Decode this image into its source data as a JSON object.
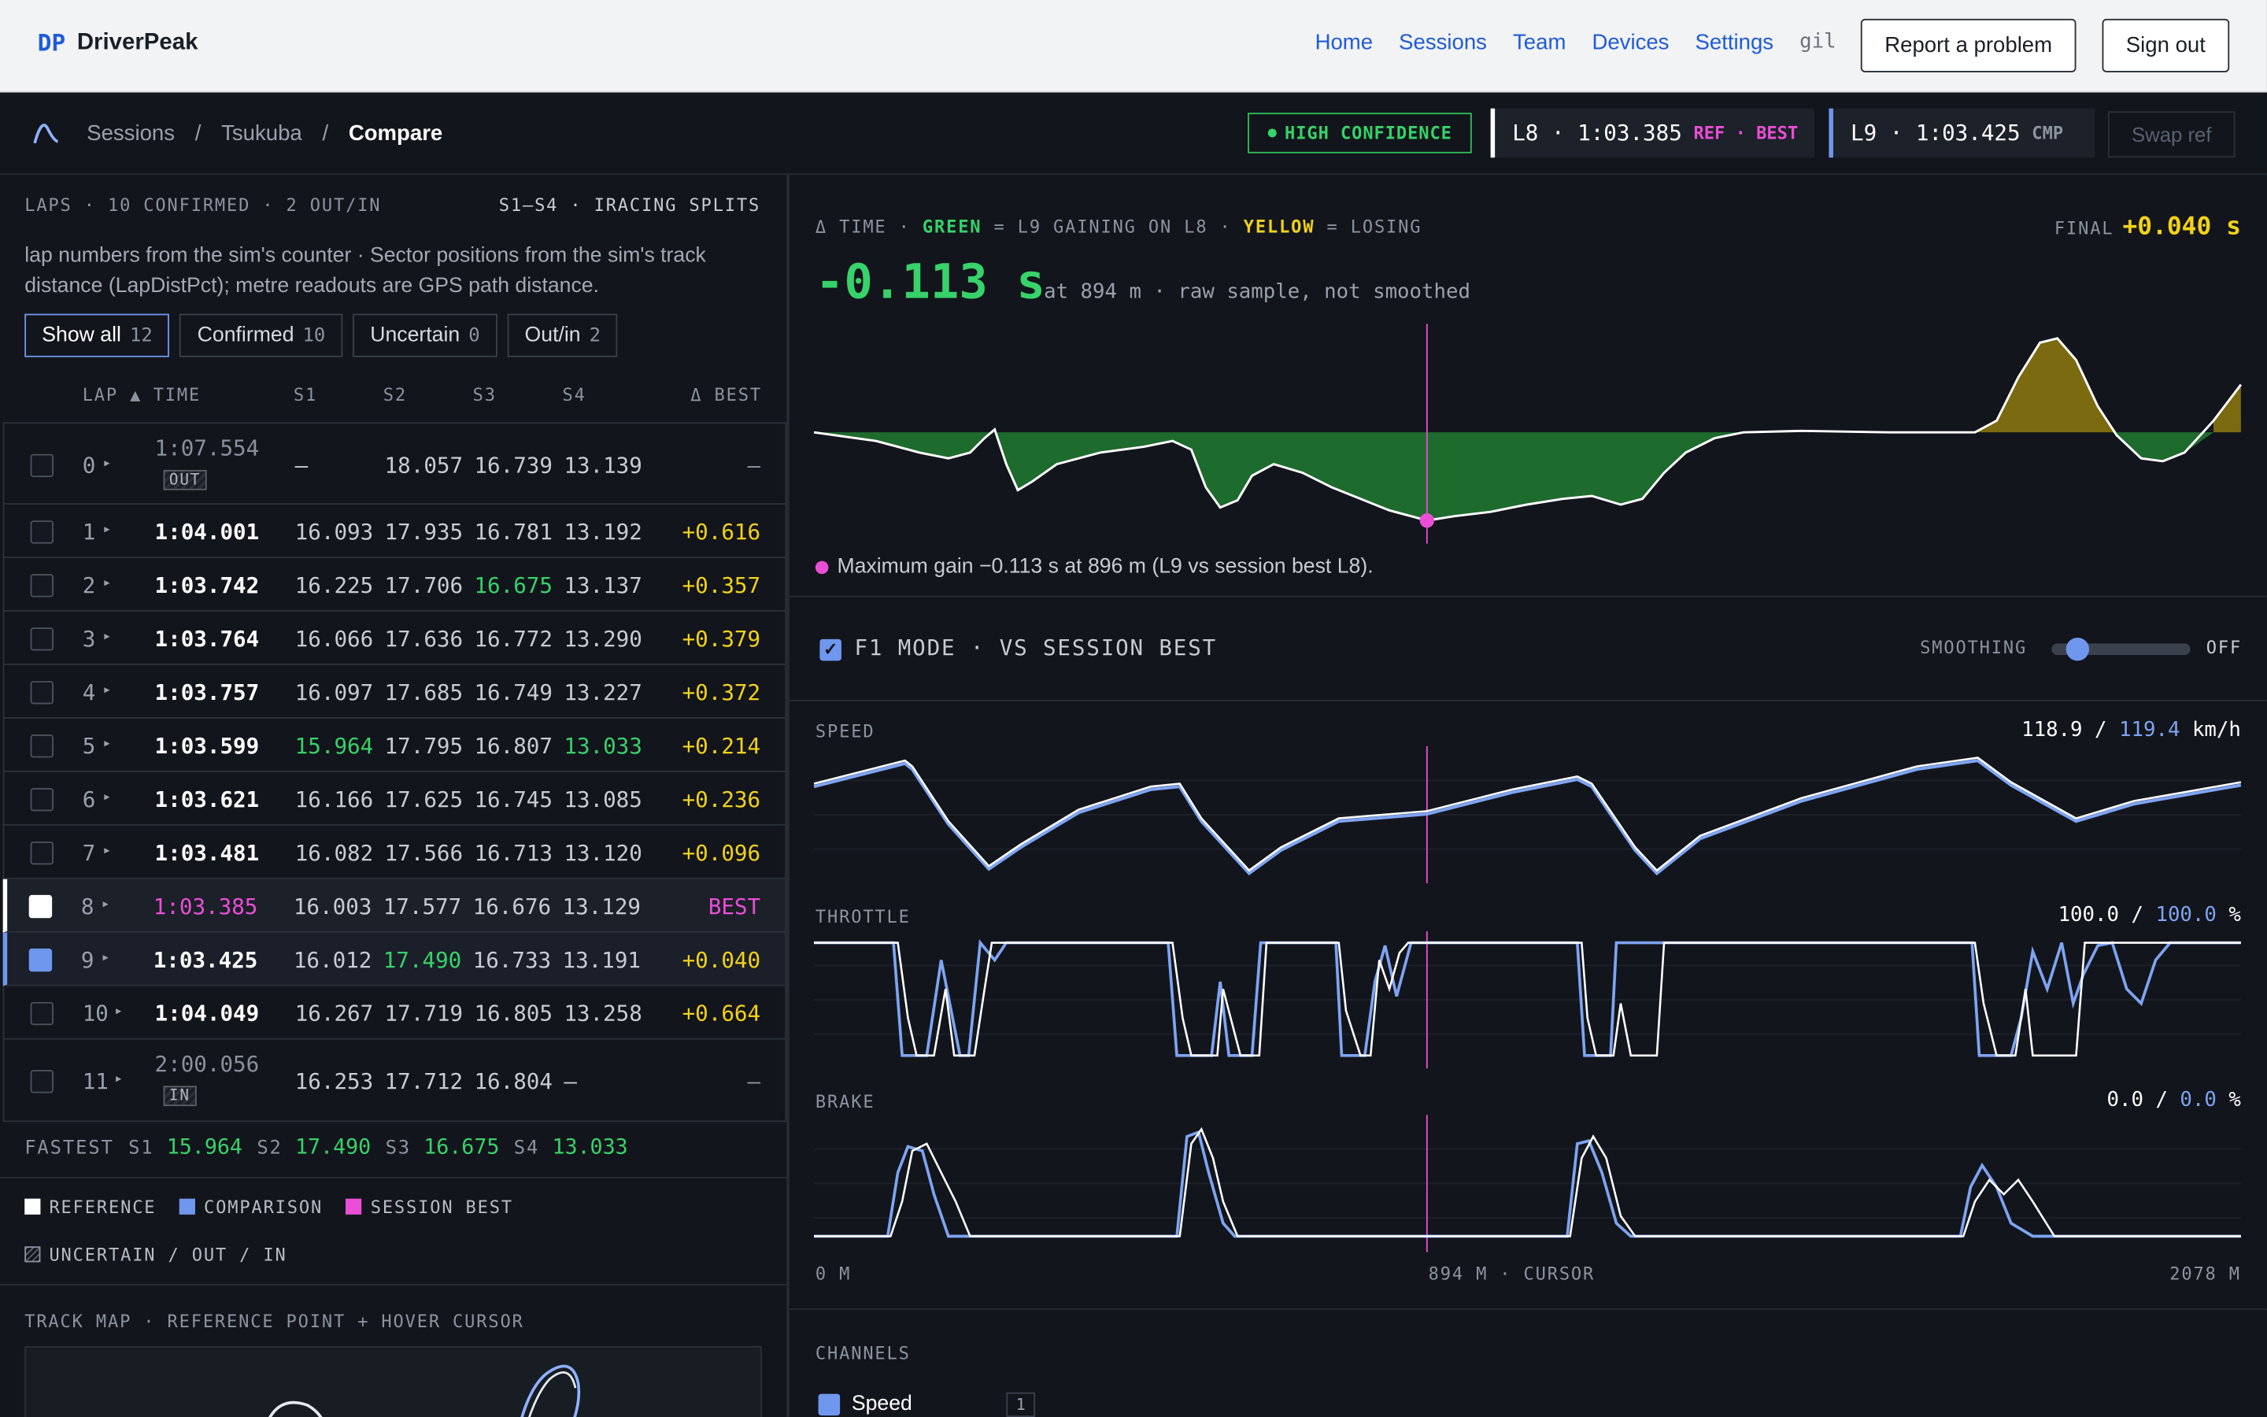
{
  "app": {
    "logo_mark": "DP",
    "name": "DriverPeak"
  },
  "nav": {
    "links": [
      "Home",
      "Sessions",
      "Team",
      "Devices",
      "Settings"
    ],
    "user": "gil",
    "report_label": "Report a problem",
    "signout_label": "Sign out"
  },
  "breadcrumb": {
    "items": [
      "Sessions",
      "Tsukuba",
      "Compare"
    ]
  },
  "confidence": "HIGH CONFIDENCE",
  "ref_chip": {
    "text": "L8 · 1:03.385",
    "tag": "REF · BEST",
    "color": "#ffffff"
  },
  "cmp_chip": {
    "text": "L9 · 1:03.425",
    "tag": "CMP",
    "color": "#6f97ee"
  },
  "swap_label": "Swap ref",
  "laps_panel": {
    "heading": "LAPS · 10 CONFIRMED · 2 OUT/IN",
    "splits_label": "S1–S4 · IRACING SPLITS",
    "description": "lap numbers from the sim's counter · Sector positions from the sim's track distance (LapDistPct); metre readouts are GPS path distance.",
    "filters": [
      {
        "label": "Show all",
        "count": "12"
      },
      {
        "label": "Confirmed",
        "count": "10"
      },
      {
        "label": "Uncertain",
        "count": "0"
      },
      {
        "label": "Out/in",
        "count": "2"
      }
    ],
    "columns": [
      "LAP ▲",
      "TIME",
      "S1",
      "S2",
      "S3",
      "S4",
      "Δ BEST"
    ],
    "rows": [
      {
        "lap": "0",
        "time": "1:07.554",
        "badge": "OUT",
        "s1": "—",
        "s2": "18.057",
        "s3": "16.739",
        "s4": "13.139",
        "delta": "—",
        "kind": "out",
        "green": []
      },
      {
        "lap": "1",
        "time": "1:04.001",
        "badge": "",
        "s1": "16.093",
        "s2": "17.935",
        "s3": "16.781",
        "s4": "13.192",
        "delta": "+0.616",
        "kind": "normal",
        "green": []
      },
      {
        "lap": "2",
        "time": "1:03.742",
        "badge": "",
        "s1": "16.225",
        "s2": "17.706",
        "s3": "16.675",
        "s4": "13.137",
        "delta": "+0.357",
        "kind": "normal",
        "green": [
          "s3"
        ]
      },
      {
        "lap": "3",
        "time": "1:03.764",
        "badge": "",
        "s1": "16.066",
        "s2": "17.636",
        "s3": "16.772",
        "s4": "13.290",
        "delta": "+0.379",
        "kind": "normal",
        "green": []
      },
      {
        "lap": "4",
        "time": "1:03.757",
        "badge": "",
        "s1": "16.097",
        "s2": "17.685",
        "s3": "16.749",
        "s4": "13.227",
        "delta": "+0.372",
        "kind": "normal",
        "green": []
      },
      {
        "lap": "5",
        "time": "1:03.599",
        "badge": "",
        "s1": "15.964",
        "s2": "17.795",
        "s3": "16.807",
        "s4": "13.033",
        "delta": "+0.214",
        "kind": "normal",
        "green": [
          "s1",
          "s4"
        ]
      },
      {
        "lap": "6",
        "time": "1:03.621",
        "badge": "",
        "s1": "16.166",
        "s2": "17.625",
        "s3": "16.745",
        "s4": "13.085",
        "delta": "+0.236",
        "kind": "normal",
        "green": []
      },
      {
        "lap": "7",
        "time": "1:03.481",
        "badge": "",
        "s1": "16.082",
        "s2": "17.566",
        "s3": "16.713",
        "s4": "13.120",
        "delta": "+0.096",
        "kind": "normal",
        "green": []
      },
      {
        "lap": "8",
        "time": "1:03.385",
        "badge": "",
        "s1": "16.003",
        "s2": "17.577",
        "s3": "16.676",
        "s4": "13.129",
        "delta": "BEST",
        "kind": "ref",
        "green": []
      },
      {
        "lap": "9",
        "time": "1:03.425",
        "badge": "",
        "s1": "16.012",
        "s2": "17.490",
        "s3": "16.733",
        "s4": "13.191",
        "delta": "+0.040",
        "kind": "cmp",
        "green": [
          "s2"
        ]
      },
      {
        "lap": "10",
        "time": "1:04.049",
        "badge": "",
        "s1": "16.267",
        "s2": "17.719",
        "s3": "16.805",
        "s4": "13.258",
        "delta": "+0.664",
        "kind": "normal",
        "green": []
      },
      {
        "lap": "11",
        "time": "2:00.056",
        "badge": "IN",
        "s1": "16.253",
        "s2": "17.712",
        "s3": "16.804",
        "s4": "—",
        "delta": "—",
        "kind": "in",
        "green": []
      }
    ],
    "fastest": {
      "label": "FASTEST",
      "s1_k": "S1",
      "s1": "15.964",
      "s2_k": "S2",
      "s2": "17.490",
      "s3_k": "S3",
      "s3": "16.675",
      "s4_k": "S4",
      "s4": "13.033"
    },
    "legend": {
      "reference": "REFERENCE",
      "comparison": "COMPARISON",
      "session_best": "SESSION BEST",
      "uncertain": "UNCERTAIN / OUT / IN"
    },
    "track_heading": "TRACK MAP · REFERENCE POINT + HOVER CURSOR"
  },
  "delta_panel": {
    "heading_prefix": "Δ TIME · ",
    "heading_green": "GREEN",
    "heading_mid": " = L9 GAINING ON L8 · ",
    "heading_yellow": "YELLOW",
    "heading_suffix": " = LOSING",
    "final_label": "FINAL",
    "final_value": "+0.040 s",
    "current_value": "-0.113 s",
    "current_meta": "at 894 m · raw sample, not smoothed",
    "note": "Maximum gain −0.113 s at 896 m (L9 vs session best L8).",
    "colors": {
      "gain": "#1e6b2e",
      "lose": "#7c6a10"
    }
  },
  "f1_mode": {
    "label": "F1 MODE · VS SESSION BEST",
    "checked": true,
    "smoothing_label": "SMOOTHING",
    "smoothing_state": "OFF",
    "smoothing_level": 0.1
  },
  "channels": {
    "speed": {
      "label": "SPEED",
      "ref": "118.9",
      "cmp": "119.4",
      "unit": "km/h"
    },
    "throttle": {
      "label": "THROTTLE",
      "ref": "100.0",
      "cmp": "100.0",
      "unit": "%"
    },
    "brake": {
      "label": "BRAKE",
      "ref": "0.0",
      "cmp": "0.0",
      "unit": "%"
    },
    "axis_start": "0 M",
    "axis_cursor": "894 M · CURSOR",
    "axis_end": "2078 M"
  },
  "channel_list": {
    "heading": "CHANNELS",
    "items": [
      {
        "label": "Speed",
        "num": "1"
      }
    ]
  }
}
